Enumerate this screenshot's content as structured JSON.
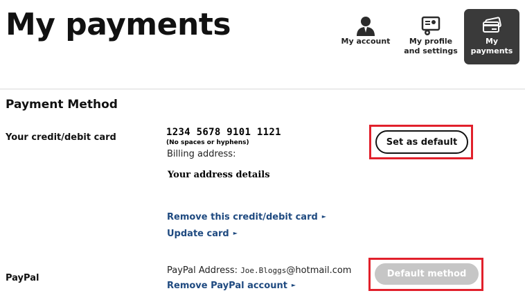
{
  "page": {
    "title": "My payments"
  },
  "nav": {
    "items": [
      {
        "label_line1": "My account",
        "label_line2": "",
        "icon": "user-icon",
        "active": false
      },
      {
        "label_line1": "My profile",
        "label_line2": "and settings",
        "icon": "profile-settings-icon",
        "active": false
      },
      {
        "label_line1": "My",
        "label_line2": "payments",
        "icon": "credit-card-icon",
        "active": true
      }
    ]
  },
  "payment_method": {
    "heading": "Payment Method",
    "card": {
      "label": "Your credit/debit card",
      "number": "1234 5678 9101 1121",
      "hint": "(No spaces or hyphens)",
      "billing_label": "Billing address:",
      "address": "Your address details",
      "set_default_label": "Set as default",
      "remove_link": "Remove this credit/debit card",
      "update_link": "Update card"
    },
    "paypal": {
      "label": "PayPal",
      "address_label": "PayPal Address:",
      "email_name": "Joe.Bloggs",
      "email_domain": "@hotmail.com",
      "remove_link": "Remove PayPal account",
      "default_label": "Default method"
    }
  },
  "colors": {
    "link": "#1f4a80",
    "highlight": "#e1202b",
    "active_nav": "#3a3a3a",
    "disabled_button": "#c6c6c6"
  }
}
